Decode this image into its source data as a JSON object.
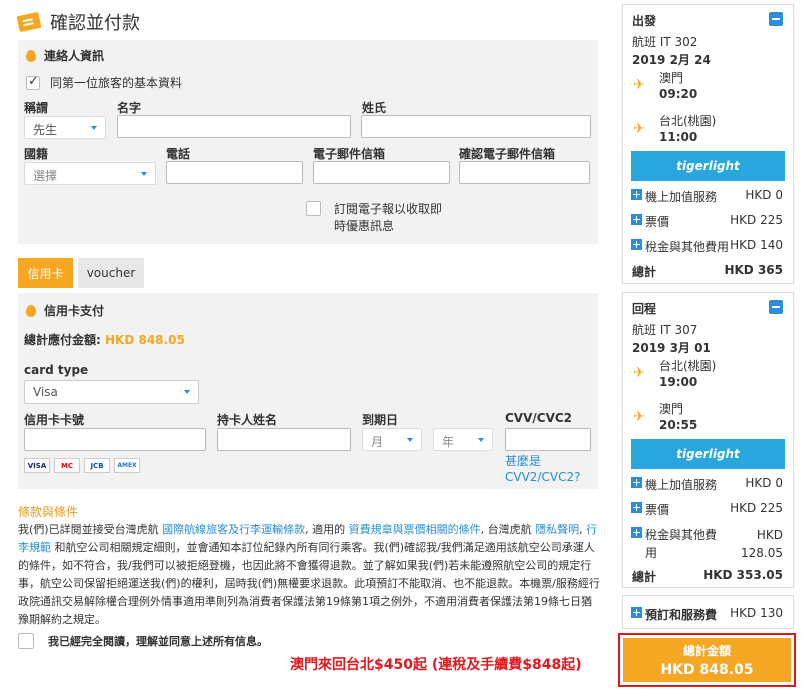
{
  "page": {
    "title": "確認並付款"
  },
  "contact": {
    "heading": "連絡人資訊",
    "same_as_first": "同第一位旅客的基本資料",
    "labels": {
      "salutation": "稱謂",
      "first_name": "名字",
      "last_name": "姓氏",
      "nationality": "國籍",
      "phone": "電話",
      "email": "電子郵件信箱",
      "confirm_email": "確認電子郵件信箱"
    },
    "salutation_value": "先生",
    "nationality_value": "選擇",
    "newsletter_line1": "訂閱電子報以收取即",
    "newsletter_line2": "時優惠訊息"
  },
  "tabs": {
    "credit_card": "信用卡",
    "voucher": "voucher"
  },
  "card": {
    "heading": "信用卡支付",
    "total_label": "總計應付金額:",
    "total_value": "HKD 848.05",
    "card_type_label": "card type",
    "card_type_value": "Visa",
    "number_label": "信用卡卡號",
    "holder_label": "持卡人姓名",
    "expiry_label": "到期日",
    "month_placeholder": "月",
    "year_placeholder": "年",
    "cvv_label": "CVV/CVC2",
    "cvv_help_1": "甚麼是",
    "cvv_help_2": "CVV2/CVC2?",
    "logos": [
      "VISA",
      "MC",
      "JCB",
      "AMEX"
    ]
  },
  "terms": {
    "title": "條款與條件",
    "p1": "我(們)已詳閱並接受台灣虎航 ",
    "l1": "國際航線旅客及行李運輸條款",
    "p2": ", 適用的 ",
    "l2": "資費規章與票價相關的條件",
    "p3": ", 台灣虎航 ",
    "l3": "隱私聲明",
    "p4": ", ",
    "l4": "行李規範",
    "p5": " 和航空公司相關規定細則，並會通知本訂位紀錄內所有同行乘客。我(們)確認我/我們滿足適用該航空公司承運人的條件，如不符合，我/我們可以被拒絕登機，也因此將不會獲得退款。並了解如果我(們)若未能遵照航空公司的規定行事，航空公司保留拒絕運送我(們)的權利，屆時我(們)無權要求退款。此項預訂不能取消、也不能退款。本機票/服務經行政院通訊交易解除權合理例外情事適用準則列為消費者保護法第19條第1項之例外，不適用消費者保護法第19條七日猶豫期解約之規定。",
    "agree": "我已經完全閱讀，理解並同意上述所有信息。"
  },
  "promo": "澳門來回台北$450起 (連稅及手續費$848起)",
  "outbound": {
    "heading": "出發",
    "flight": "航班 IT 302",
    "date": "2019 2月 24",
    "dep_airport": "澳門",
    "dep_time": "09:20",
    "arr_airport": "台北(桃園)",
    "arr_time": "11:00",
    "brand": "tigerlight",
    "rows": [
      {
        "label": "機上加值服務",
        "value": "HKD 0"
      },
      {
        "label": "票價",
        "value": "HKD 225"
      },
      {
        "label": "稅金與其他費用",
        "value": "HKD 140"
      }
    ],
    "total_label": "總計",
    "total_value": "HKD 365"
  },
  "inbound": {
    "heading": "回程",
    "flight": "航班 IT 307",
    "date": "2019 3月 01",
    "dep_airport": "台北(桃園)",
    "dep_time": "19:00",
    "arr_airport": "澳門",
    "arr_time": "20:55",
    "brand": "tigerlight",
    "rows": [
      {
        "label": "機上加值服務",
        "value": "HKD 0"
      },
      {
        "label": "票價",
        "value": "HKD 225"
      },
      {
        "label_1": "稅金與其他費",
        "label_2": "用",
        "value_1": "HKD",
        "value_2": "128.05"
      }
    ],
    "total_label": "總計",
    "total_value": "HKD 353.05"
  },
  "booking_fee": {
    "label": "預訂和服務費",
    "value": "HKD 130"
  },
  "grand_total": {
    "label": "總計金額",
    "value": "HKD 848.05"
  },
  "colors": {
    "accent": "#f5a623",
    "link": "#2a8fd6",
    "promo": "#e0191f",
    "brand": "#2aa6df"
  }
}
